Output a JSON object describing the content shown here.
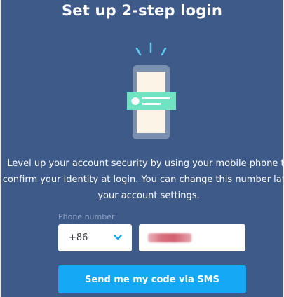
{
  "page": {
    "title": "Set up 2-step login",
    "description_lines": [
      "Level up your account security by using your mobile phone to",
      "confirm your identity at login. You can change this number later",
      "your account settings."
    ]
  },
  "form": {
    "phone_label": "Phone number",
    "country_code": "+86",
    "phone_value": "",
    "send_button_label": "Send me my code via SMS"
  },
  "colors": {
    "background": "#3e5a89",
    "button": "#14a8f5",
    "accent_green": "#6fe3c2",
    "phone_body": "#7b8fb0",
    "phone_screen": "#fdf4e8",
    "signal": "#5cc9f5"
  },
  "icons": {
    "hero": "phone-with-notification-icon",
    "dropdown": "chevron-down-icon"
  }
}
